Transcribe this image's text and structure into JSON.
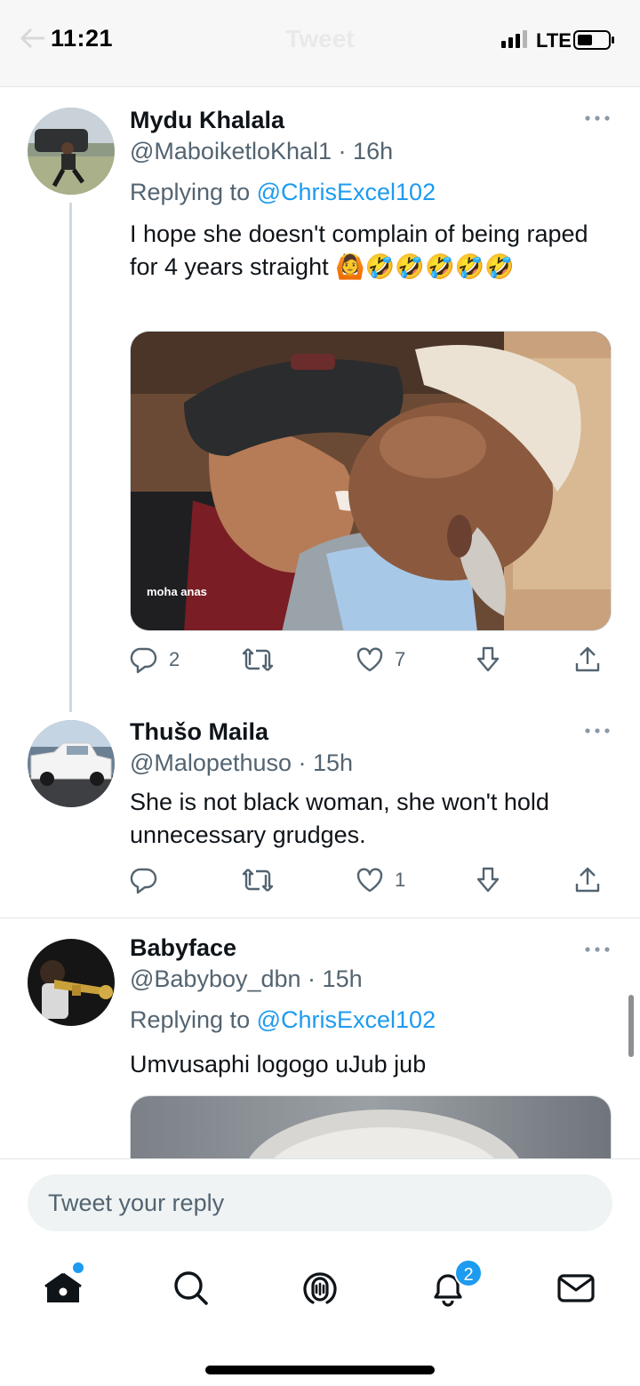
{
  "status_bar": {
    "time": "11:21",
    "network": "LTE"
  },
  "header": {
    "title": "Tweet"
  },
  "tweets": [
    {
      "name": "Mydu Khalala",
      "handle": "@MaboiketloKhal1",
      "time": "16h",
      "replying_prefix": "Replying to",
      "replying_to": "@ChrisExcel102",
      "text": "I hope she doesn't  complain of  being raped for 4 years straight 🙆🤣🤣🤣🤣🤣",
      "media_watermark": "moha anas",
      "reply_count": "2",
      "retweet_count": "",
      "like_count": "7"
    },
    {
      "name": "Thušo Maila",
      "handle": "@Malopethuso",
      "time": "15h",
      "text": "She is not black woman, she won't hold unnecessary grudges.",
      "reply_count": "",
      "retweet_count": "",
      "like_count": "1"
    },
    {
      "name": "Babyface",
      "handle": "@Babyboy_dbn",
      "time": "15h",
      "replying_prefix": "Replying to",
      "replying_to": "@ChrisExcel102",
      "text": "Umvusaphi logogo uJub jub"
    }
  ],
  "reply_bar": {
    "placeholder": "Tweet your reply"
  },
  "tab_bar": {
    "items": [
      "home-icon",
      "search-icon",
      "spaces-icon",
      "notifications-icon",
      "messages-icon"
    ],
    "notification_badge": "2"
  },
  "colors": {
    "accent": "#1d9bf0",
    "text": "#0f1419",
    "secondary": "#536471"
  }
}
